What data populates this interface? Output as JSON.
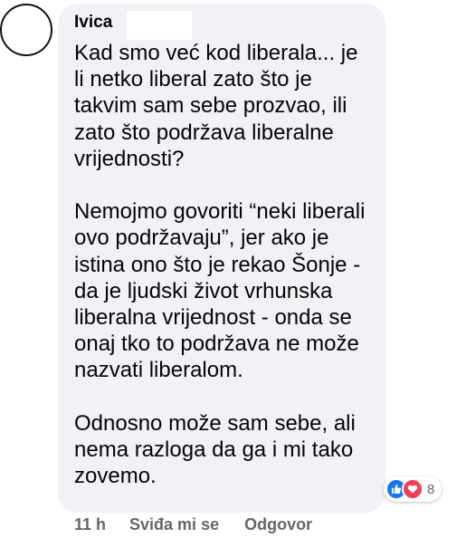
{
  "comment": {
    "author": "Ivica",
    "paragraphs": [
      "Kad smo već kod liberala... je\nli netko liberal zato što je\ntakvim sam sebe prozvao, ili\nzato što podržava liberalne\nvrijednosti?",
      "Nemojmo govoriti “neki liberali\novo podržavaju”, jer ako je\nistina ono što je rekao Šonje -\nda je ljudski život vrhunska\nliberalna vrijednost - onda se\nonaj tko to podržava ne može\nnazvati liberalom.",
      "Odnosno može sam sebe, ali\nnema razloga da ga i mi tako\nzovemo."
    ],
    "reactions": {
      "icons": [
        "like-icon",
        "love-icon"
      ],
      "count": "8",
      "like_color": "#1877f2",
      "love_color": "#f33e58"
    }
  },
  "meta": {
    "time": "11 h",
    "like_label": "Sviđa mi se",
    "reply_label": "Odgovor"
  },
  "colors": {
    "bubble": "#f0f2f5",
    "text": "#050505",
    "secondary": "#65676b"
  }
}
